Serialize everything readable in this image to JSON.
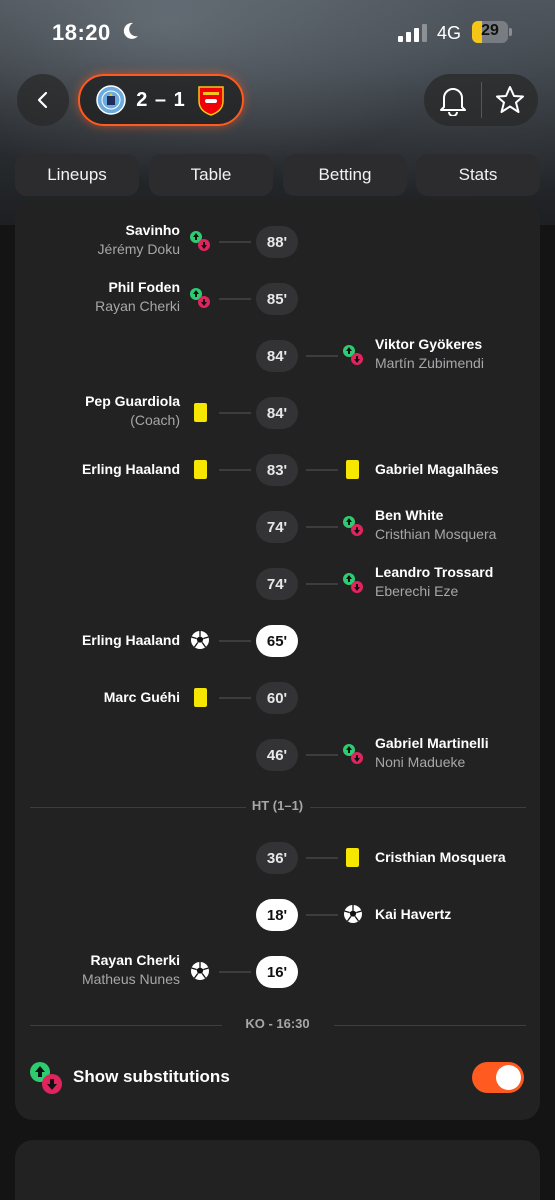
{
  "status": {
    "time": "18:20",
    "network": "4G",
    "battery": "29",
    "battery_level": 0.29
  },
  "match": {
    "score": "2 – 1",
    "home_team": "Manchester City",
    "away_team": "Arsenal",
    "home_color": "#6cabdd",
    "away_color": "#ef0107"
  },
  "tabs": [
    "Lineups",
    "Table",
    "Betting",
    "Stats"
  ],
  "events": [
    {
      "minute": "88'",
      "side": "home",
      "type": "sub",
      "primary": "Savinho",
      "secondary": "Jérémy Doku"
    },
    {
      "minute": "85'",
      "side": "home",
      "type": "sub",
      "primary": "Phil Foden",
      "secondary": "Rayan Cherki"
    },
    {
      "minute": "84'",
      "side": "away",
      "type": "sub",
      "primary": "Viktor Gyökeres",
      "secondary": "Martín Zubimendi"
    },
    {
      "minute": "84'",
      "side": "home",
      "type": "yellow",
      "primary": "Pep Guardiola",
      "secondary": "(Coach)"
    },
    {
      "minute": "83'",
      "side": "both",
      "type": "yellow",
      "primary": "Erling Haaland",
      "primary_away": "Gabriel Magalhães"
    },
    {
      "minute": "74'",
      "side": "away",
      "type": "sub",
      "primary": "Ben White",
      "secondary": "Cristhian Mosquera"
    },
    {
      "minute": "74'",
      "side": "away",
      "type": "sub",
      "primary": "Leandro Trossard",
      "secondary": "Eberechi Eze"
    },
    {
      "minute": "65'",
      "side": "home",
      "type": "goal",
      "primary": "Erling Haaland"
    },
    {
      "minute": "60'",
      "side": "home",
      "type": "yellow",
      "primary": "Marc Guéhi"
    },
    {
      "minute": "46'",
      "side": "away",
      "type": "sub",
      "primary": "Gabriel Martinelli",
      "secondary": "Noni Madueke"
    },
    {
      "minute": "36'",
      "side": "away",
      "type": "yellow",
      "primary": "Cristhian Mosquera"
    },
    {
      "minute": "18'",
      "side": "away",
      "type": "goal",
      "primary": "Kai Havertz"
    },
    {
      "minute": "16'",
      "side": "home",
      "type": "goal",
      "primary": "Rayan Cherki",
      "secondary": "Matheus Nunes"
    }
  ],
  "separators": {
    "half_time": "HT (1–1)",
    "kick_off": "KO - 16:30"
  },
  "show_substitutions": {
    "label": "Show substitutions",
    "enabled": true
  },
  "colors": {
    "accent": "#ff5a1f",
    "yellow_card": "#f7e600",
    "sub_in": "#2ecc71",
    "sub_out": "#e0245e"
  }
}
